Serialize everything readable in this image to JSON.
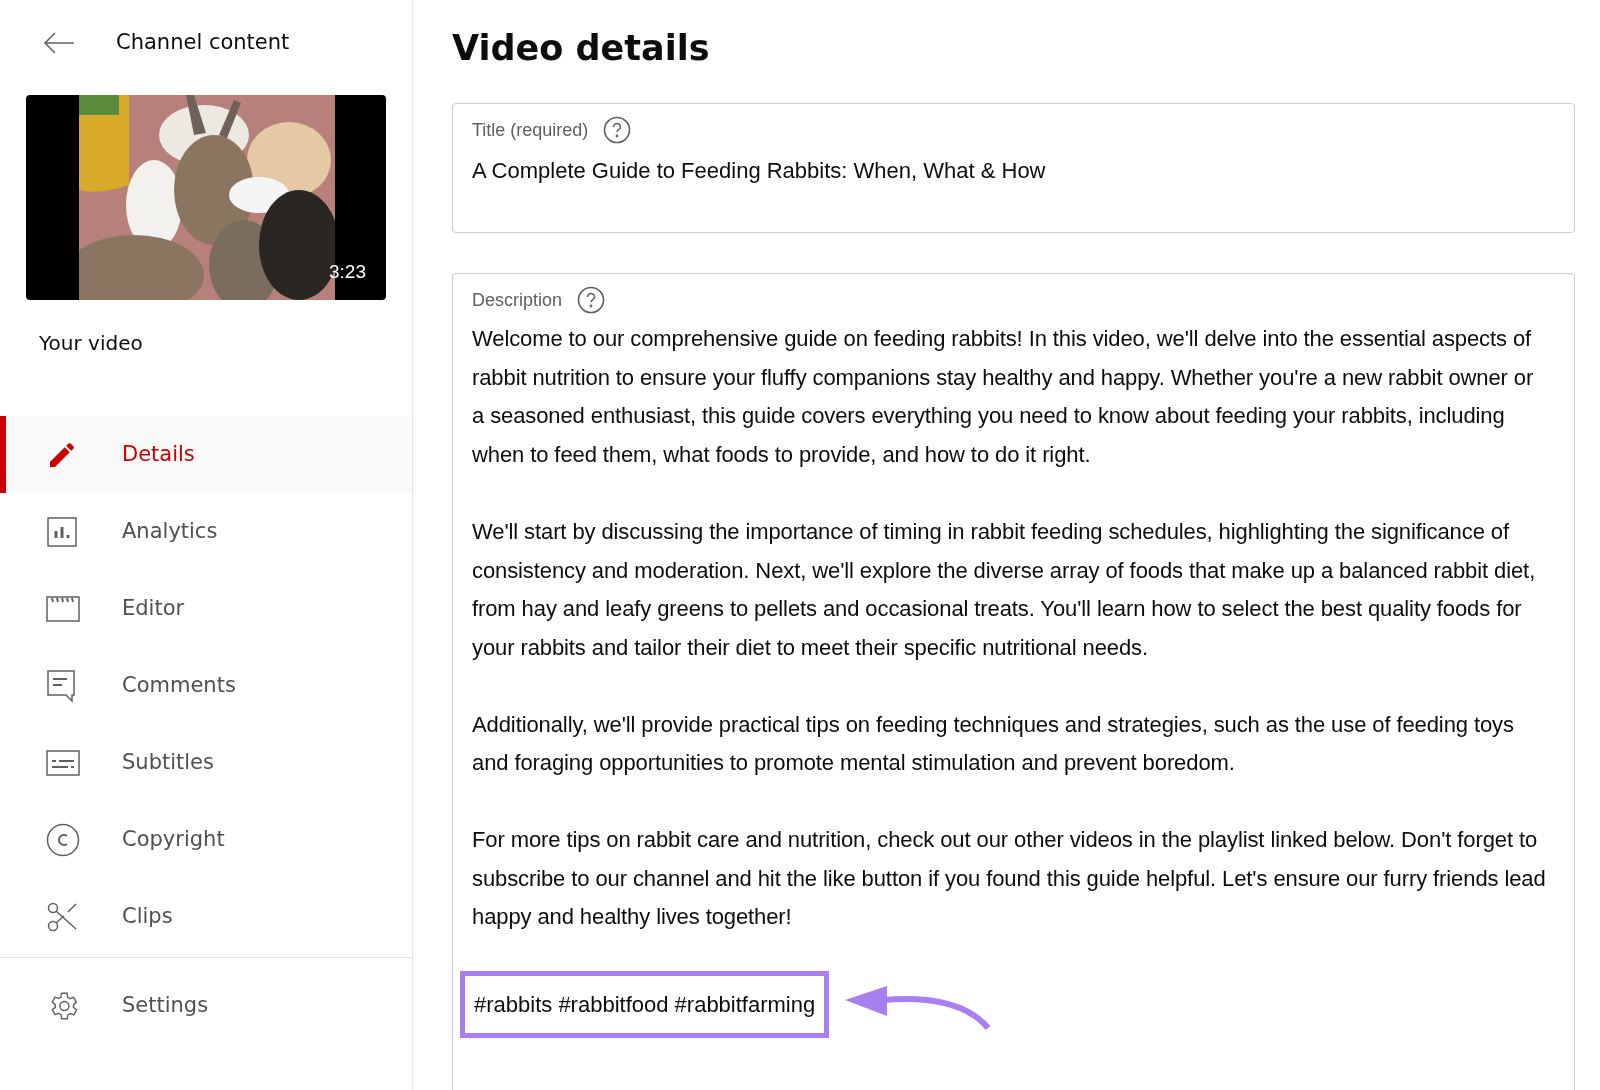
{
  "header": {
    "title": "Channel content"
  },
  "video": {
    "duration": "3:23",
    "label": "Your video"
  },
  "nav_items": [
    {
      "label": "Details",
      "selected": true
    },
    {
      "label": "Analytics",
      "selected": false
    },
    {
      "label": "Editor",
      "selected": false
    },
    {
      "label": "Comments",
      "selected": false
    },
    {
      "label": "Subtitles",
      "selected": false
    },
    {
      "label": "Copyright",
      "selected": false
    },
    {
      "label": "Clips",
      "selected": false
    }
  ],
  "footer_items": [
    {
      "label": "Settings",
      "selected": false
    }
  ],
  "page_title": "Video details",
  "title_field": {
    "label": "Title (required)",
    "value": "A Complete Guide to Feeding Rabbits: When, What & How"
  },
  "description_field": {
    "label": "Description",
    "paragraphs": [
      "Welcome to our comprehensive guide on feeding rabbits! In this video, we'll delve into the essential aspects of rabbit nutrition to ensure your fluffy companions stay healthy and happy. Whether you're a new rabbit owner or a seasoned enthusiast, this guide covers everything you need to know about feeding your rabbits, including when to feed them, what foods to provide, and how to do it right.",
      "We'll start by discussing the importance of timing in rabbit feeding schedules, highlighting the significance of consistency and moderation. Next, we'll explore the diverse array of foods that make up a balanced rabbit diet, from hay and leafy greens to pellets and occasional treats. You'll learn how to select the best quality foods for your rabbits and tailor their diet to meet their specific nutritional needs.",
      "Additionally, we'll provide practical tips on feeding techniques and strategies, such as the use of feeding toys and foraging opportunities to promote mental stimulation and prevent boredom.",
      "For more tips on rabbit care and nutrition, check out our other videos in the playlist linked below. Don't forget to subscribe to our channel and hit the like button if you found this guide helpful. Let's ensure our furry friends lead happy and healthy lives together!"
    ],
    "hashtags": "#rabbits #rabbitfood #rabbitfarming"
  }
}
